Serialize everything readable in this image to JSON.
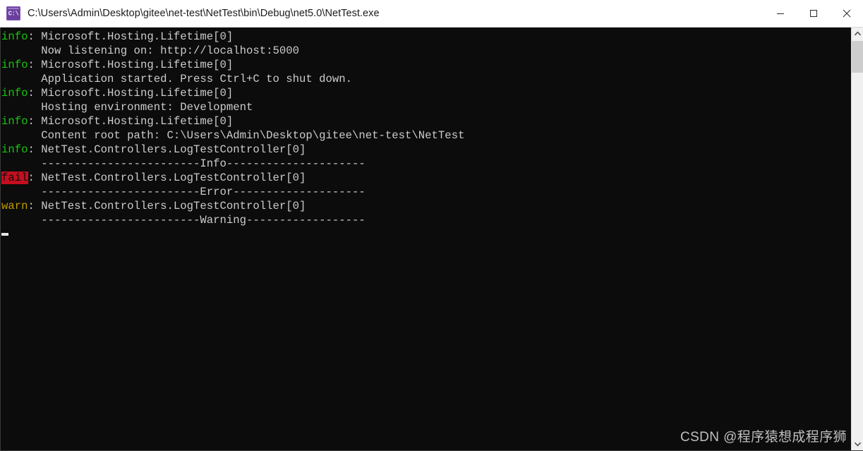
{
  "window": {
    "title": "C:\\Users\\Admin\\Desktop\\gitee\\net-test\\NetTest\\bin\\Debug\\net5.0\\NetTest.exe",
    "icon_glyph": "C:\\",
    "icon_name": "console-app-icon",
    "controls": {
      "minimize_label": "Minimize",
      "maximize_label": "Maximize",
      "close_label": "Close"
    }
  },
  "colors": {
    "console_background": "#0c0c0c",
    "console_text": "#cccccc",
    "info_green": "#16c60c",
    "warn_yellow": "#c19c00",
    "fail_background": "#c50f1f",
    "fail_text": "#0c0c0c",
    "titlebar_background": "#ffffff",
    "scrollbar_track": "#f0f0f0",
    "scrollbar_thumb": "#cdcdcd"
  },
  "console": {
    "lines": [
      {
        "level": "info",
        "level_text": "info",
        "message": ": Microsoft.Hosting.Lifetime[0]"
      },
      {
        "level": "none",
        "level_text": "",
        "message": "      Now listening on: http://localhost:5000"
      },
      {
        "level": "info",
        "level_text": "info",
        "message": ": Microsoft.Hosting.Lifetime[0]"
      },
      {
        "level": "none",
        "level_text": "",
        "message": "      Application started. Press Ctrl+C to shut down."
      },
      {
        "level": "info",
        "level_text": "info",
        "message": ": Microsoft.Hosting.Lifetime[0]"
      },
      {
        "level": "none",
        "level_text": "",
        "message": "      Hosting environment: Development"
      },
      {
        "level": "info",
        "level_text": "info",
        "message": ": Microsoft.Hosting.Lifetime[0]"
      },
      {
        "level": "none",
        "level_text": "",
        "message": "      Content root path: C:\\Users\\Admin\\Desktop\\gitee\\net-test\\NetTest"
      },
      {
        "level": "info",
        "level_text": "info",
        "message": ": NetTest.Controllers.LogTestController[0]"
      },
      {
        "level": "none",
        "level_text": "",
        "message": "      ------------------------Info---------------------"
      },
      {
        "level": "fail",
        "level_text": "fail",
        "message": ": NetTest.Controllers.LogTestController[0]"
      },
      {
        "level": "none",
        "level_text": "",
        "message": "      ------------------------Error--------------------"
      },
      {
        "level": "warn",
        "level_text": "warn",
        "message": ": NetTest.Controllers.LogTestController[0]"
      },
      {
        "level": "none",
        "level_text": "",
        "message": "      ------------------------Warning------------------"
      }
    ],
    "cursor_visible": true
  },
  "scrollbar": {
    "up_arrow": "scroll-up-arrow",
    "down_arrow": "scroll-down-arrow",
    "thumb_name": "scrollbar-thumb"
  },
  "watermark": {
    "text": "CSDN @程序猿想成程序狮"
  }
}
